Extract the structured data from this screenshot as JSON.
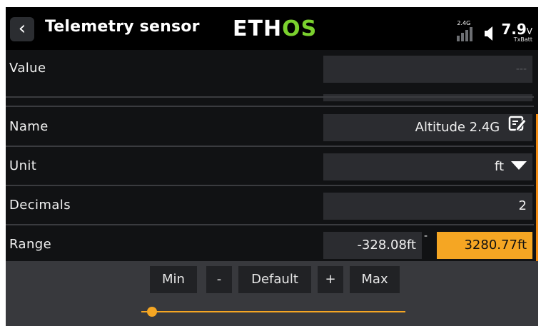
{
  "header": {
    "title": "Telemetry sensor",
    "logo": {
      "part1": "ETH",
      "part2": "OS"
    },
    "signal_label": "2.4G",
    "voltage_value": "7.9",
    "voltage_unit": "V",
    "voltage_label": "TxBatt"
  },
  "rows": {
    "value": {
      "label": "Value",
      "field": "---"
    },
    "name": {
      "label": "Name",
      "field": "Altitude 2.4G"
    },
    "unit": {
      "label": "Unit",
      "field": "ft"
    },
    "decimals": {
      "label": "Decimals",
      "field": "2"
    },
    "range": {
      "label": "Range",
      "min": "-328.08ft",
      "separator": "-",
      "max": "3280.77ft"
    }
  },
  "bottom_buttons": {
    "min": "Min",
    "minus": "-",
    "default": "Default",
    "plus": "+",
    "max": "Max"
  },
  "colors": {
    "accent": "#f5a623",
    "brand_green": "#7bd12e",
    "background": "#111214"
  }
}
